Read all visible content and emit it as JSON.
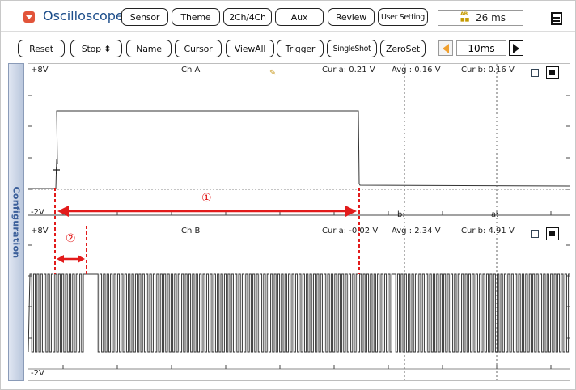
{
  "app": {
    "title": "Oscilloscope"
  },
  "toolbar_top": {
    "buttons": [
      {
        "label": "Sensor"
      },
      {
        "label": "Theme"
      },
      {
        "label": "2Ch/4Ch"
      },
      {
        "label": "Aux"
      },
      {
        "label": "Review"
      },
      {
        "label": "User Setting"
      }
    ],
    "acquire_time": "26 ms",
    "acquire_icon_top": "AB",
    "acquire_icon_bottom": "■■"
  },
  "toolbar_bottom": {
    "buttons": [
      {
        "label": "Reset"
      },
      {
        "label": "Stop  ⬍"
      },
      {
        "label": "Name"
      },
      {
        "label": "Cursor"
      },
      {
        "label": "ViewAll"
      },
      {
        "label": "Trigger"
      },
      {
        "label": "SingleShot"
      },
      {
        "label": "ZeroSet"
      }
    ],
    "timebase": "10ms"
  },
  "sidebar": {
    "tab_label": "Configuration"
  },
  "channel_a": {
    "name": "Ch A",
    "max_label": "+8V",
    "min_label": "-2V",
    "cur_a": "Cur a: 0.21 V",
    "avg": "Avg  : 0.16 V",
    "cur_b": "Cur b: 0.16 V",
    "cursor_a_label": "a:",
    "cursor_b_label": "b:"
  },
  "channel_b": {
    "name": "Ch B",
    "max_label": "+8V",
    "min_label": "-2V",
    "cur_a": "Cur a: -0.02 V",
    "avg": "Avg  : 2.34 V",
    "cur_b": "Cur b: 4.91 V"
  },
  "annotations": {
    "marker_1": "①",
    "marker_2": "②"
  },
  "colors": {
    "annotation": "#e21b1b",
    "title": "#1c4d8a",
    "trace": "#333333",
    "config_text": "#3b5f9a"
  }
}
